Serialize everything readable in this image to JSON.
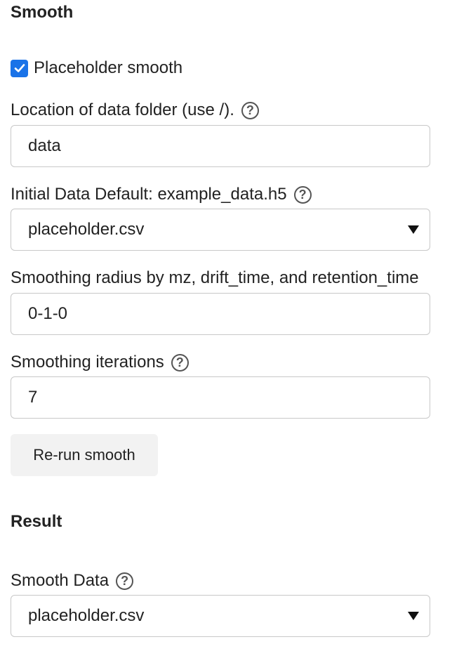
{
  "smooth_section": {
    "title": "Smooth"
  },
  "placeholder_checkbox": {
    "label": "Placeholder smooth",
    "checked": true
  },
  "data_folder": {
    "label": "Location of data folder (use /).",
    "value": "data"
  },
  "initial_data": {
    "label": "Initial Data Default: example_data.h5",
    "value": "placeholder.csv"
  },
  "smoothing_radius": {
    "label": "Smoothing radius by mz, drift_time, and retention_time",
    "value": "0-1-0"
  },
  "smoothing_iterations": {
    "label": "Smoothing iterations",
    "value": "7"
  },
  "rerun_button": {
    "label": "Re-run smooth"
  },
  "result_section": {
    "title": "Result"
  },
  "smooth_data": {
    "label": "Smooth Data",
    "value": "placeholder.csv"
  },
  "help_glyph": "?",
  "accent_color": "#1a73e8"
}
